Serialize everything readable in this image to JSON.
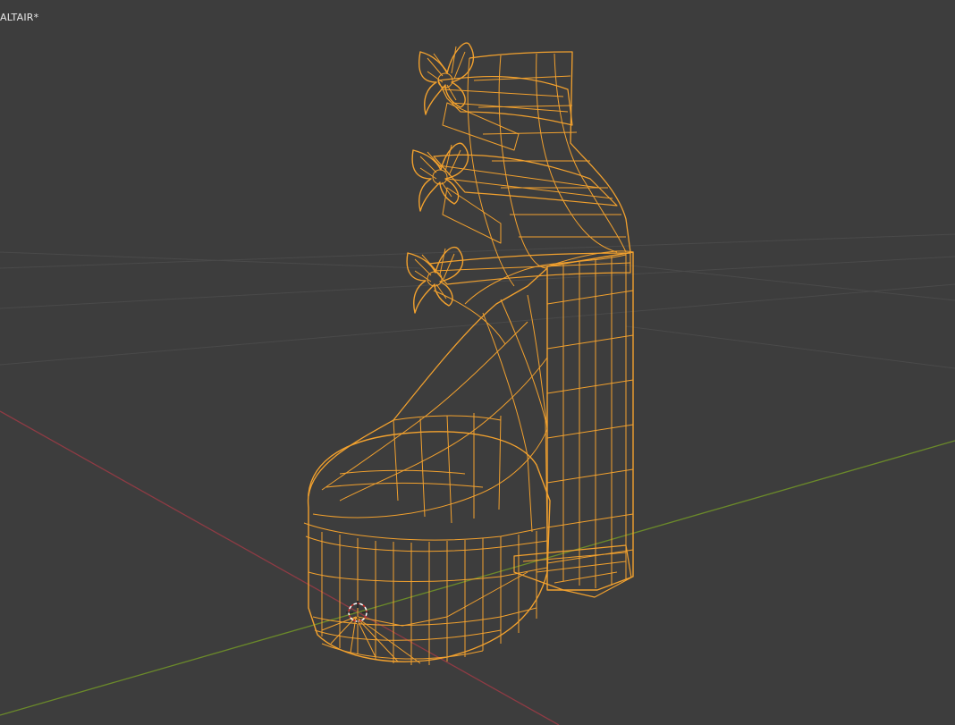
{
  "viewport": {
    "object_label": "ALTAIR*",
    "view_mode": "wireframe",
    "background_color": "#3d3d3d",
    "wire_color": "#f2a12e",
    "grid_line_color": "#4a4a4a",
    "x_axis_color": "#8e3b44",
    "y_axis_color": "#6b8a2a"
  },
  "scene": {
    "object_icon": "shoe-wireframe-icon",
    "cursor_icon": "3d-cursor-icon"
  }
}
